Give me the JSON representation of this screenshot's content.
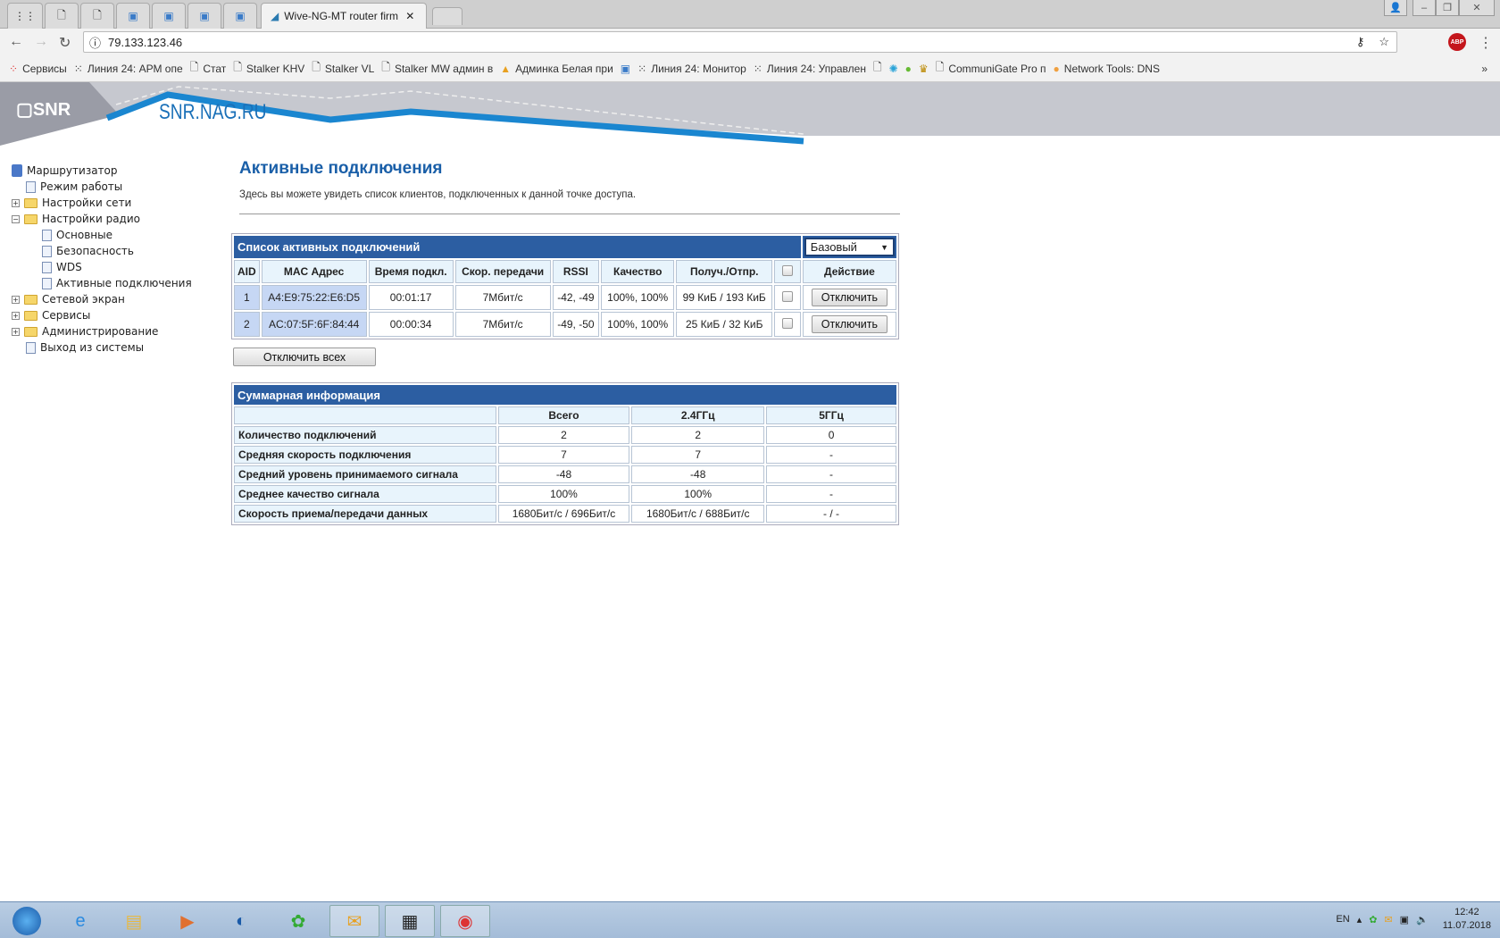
{
  "browser": {
    "active_tab_title": "Wive-NG-MT router firm",
    "url": "79.133.123.46",
    "bookmarks": [
      "Сервисы",
      "Линия 24: АРМ опе",
      "Стат",
      "Stalker KHV",
      "Stalker VL",
      "Stalker MW админ в",
      "Админка Белая при",
      "Линия 24: Монитор",
      "Линия 24: Управлен",
      "CommuniGate Pro п",
      "Network Tools: DNS"
    ],
    "abp_label": "ABP"
  },
  "banner": {
    "logo_text": "SNR",
    "site": "SNR.NAG.RU"
  },
  "sidebar": {
    "root": "Маршрутизатор",
    "items": [
      "Режим работы",
      "Настройки сети",
      "Настройки радио",
      "Основные",
      "Безопасность",
      "WDS",
      "Активные подключения",
      "Сетевой экран",
      "Сервисы",
      "Администрирование",
      "Выход из системы"
    ]
  },
  "main": {
    "title": "Активные подключения",
    "description": "Здесь вы можете увидеть список клиентов, подключенных к данной точке доступа.",
    "clients": {
      "title": "Список активных подключений",
      "mode_select": "Базовый",
      "columns": [
        "AID",
        "MAC Адрес",
        "Время подкл.",
        "Скор. передачи",
        "RSSI",
        "Качество",
        "Получ./Отпр.",
        "Действие"
      ],
      "rows": [
        {
          "aid": "1",
          "mac": "A4:E9:75:22:E6:D5",
          "time": "00:01:17",
          "rate": "7Мбит/с",
          "rssi": "-42, -49",
          "quality": "100%, 100%",
          "traffic": "99 КиБ / 193 КиБ",
          "action": "Отключить"
        },
        {
          "aid": "2",
          "mac": "AC:07:5F:6F:84:44",
          "time": "00:00:34",
          "rate": "7Мбит/с",
          "rssi": "-49, -50",
          "quality": "100%, 100%",
          "traffic": "25 КиБ / 32 КиБ",
          "action": "Отключить"
        }
      ],
      "disconnect_all": "Отключить всех"
    },
    "summary": {
      "title": "Суммарная информация",
      "columns": [
        "Всего",
        "2.4ГГц",
        "5ГГц"
      ],
      "rows": [
        {
          "label": "Количество подключений",
          "values": [
            "2",
            "2",
            "0"
          ]
        },
        {
          "label": "Средняя скорость подключения",
          "values": [
            "7",
            "7",
            "-"
          ]
        },
        {
          "label": "Средний уровень принимаемого сигнала",
          "values": [
            "-48",
            "-48",
            "-"
          ]
        },
        {
          "label": "Среднее качество сигнала",
          "values": [
            "100%",
            "100%",
            "-"
          ]
        },
        {
          "label": "Скорость приема/передачи данных",
          "values": [
            "1680Бит/с / 696Бит/с",
            "1680Бит/с / 688Бит/с",
            "- / -"
          ]
        }
      ]
    }
  },
  "taskbar": {
    "lang": "EN",
    "time": "12:42",
    "date": "11.07.2018"
  }
}
